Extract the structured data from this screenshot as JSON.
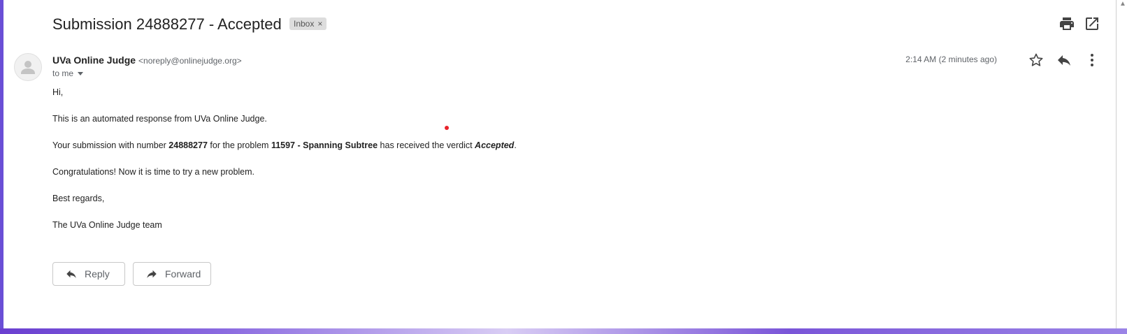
{
  "email": {
    "subject": "Submission 24888277 - Accepted",
    "label": "Inbox",
    "label_close": "×",
    "sender_name": "UVa Online Judge",
    "sender_email": "<noreply@onlinejudge.org>",
    "recipient": "to me",
    "timestamp": "2:14 AM (2 minutes ago)",
    "body": {
      "greeting": "Hi,",
      "intro": "This is an automated response from UVa Online Judge.",
      "verdict": {
        "prefix": "Your submission with number ",
        "submission_number": "24888277",
        "middle": " for the problem ",
        "problem": "11597 - Spanning Subtree",
        "suffix_text": " has received the verdict ",
        "verdict": "Accepted",
        "end": "."
      },
      "congrats": "Congratulations! Now it is time to try a new problem.",
      "closing": "Best regards,",
      "signature": "The UVa Online Judge team"
    }
  },
  "actions": {
    "reply": "Reply",
    "forward": "Forward"
  },
  "icons": {
    "print": "print-icon",
    "open_new_window": "open-in-new-window-icon",
    "star": "star-icon",
    "reply": "reply-icon",
    "more": "more-vert-icon",
    "forward": "forward-icon",
    "avatar": "default-avatar-icon"
  },
  "colors": {
    "accent_left": "#6a4fd6",
    "label_bg": "#dddddd",
    "secondary_text": "#5f6368",
    "cursor_dot": "#e8222a"
  }
}
